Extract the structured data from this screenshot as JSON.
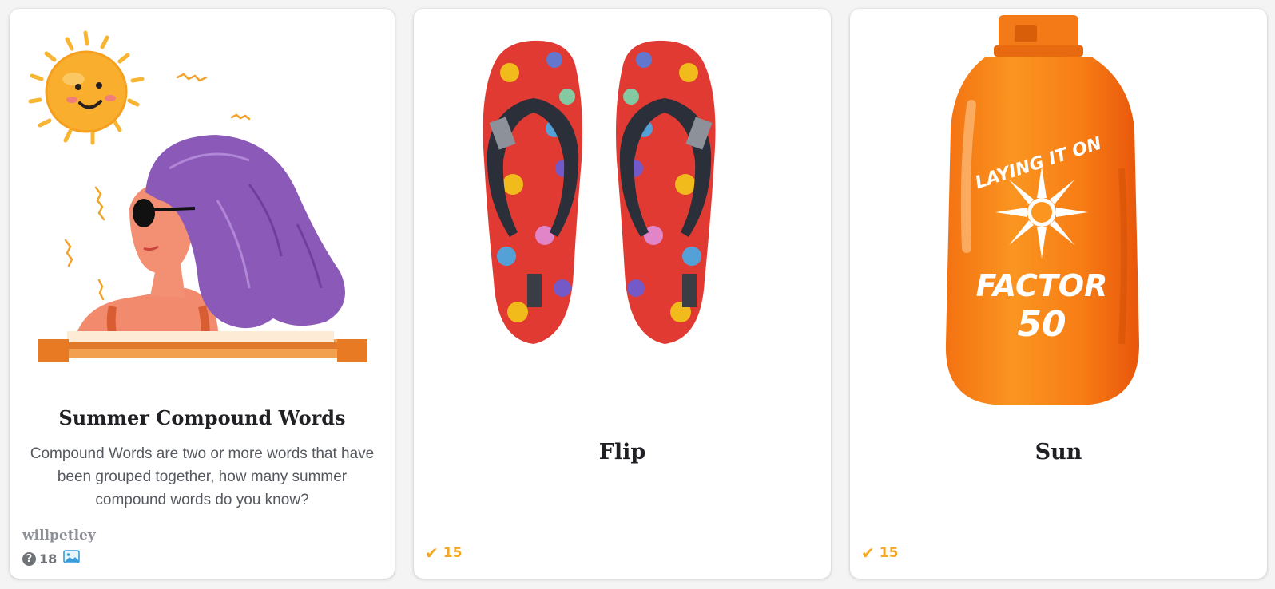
{
  "cards": [
    {
      "title": "Summer Compound Words",
      "description": "Compound Words are two or more words that have been grouped together, how many summer compound words do you know?",
      "author": "willpetley",
      "question_count": "18",
      "question_icon": "question-circle-icon",
      "image_icon": "image-icon",
      "illustration": "woman-sunbathing-with-sun"
    },
    {
      "title": "Flip",
      "completed_count": "15",
      "completed_icon": "check-icon",
      "illustration": "flip-flops"
    },
    {
      "title": "Sun",
      "completed_count": "15",
      "completed_icon": "check-icon",
      "illustration": "sunscreen-bottle",
      "bottle_text": {
        "line1": "LAYING IT ON",
        "line2": "FACTOR",
        "line3": "50"
      }
    }
  ],
  "colors": {
    "accent": "#f5a623",
    "title": "#1f1f24",
    "muted": "#6f7277"
  }
}
